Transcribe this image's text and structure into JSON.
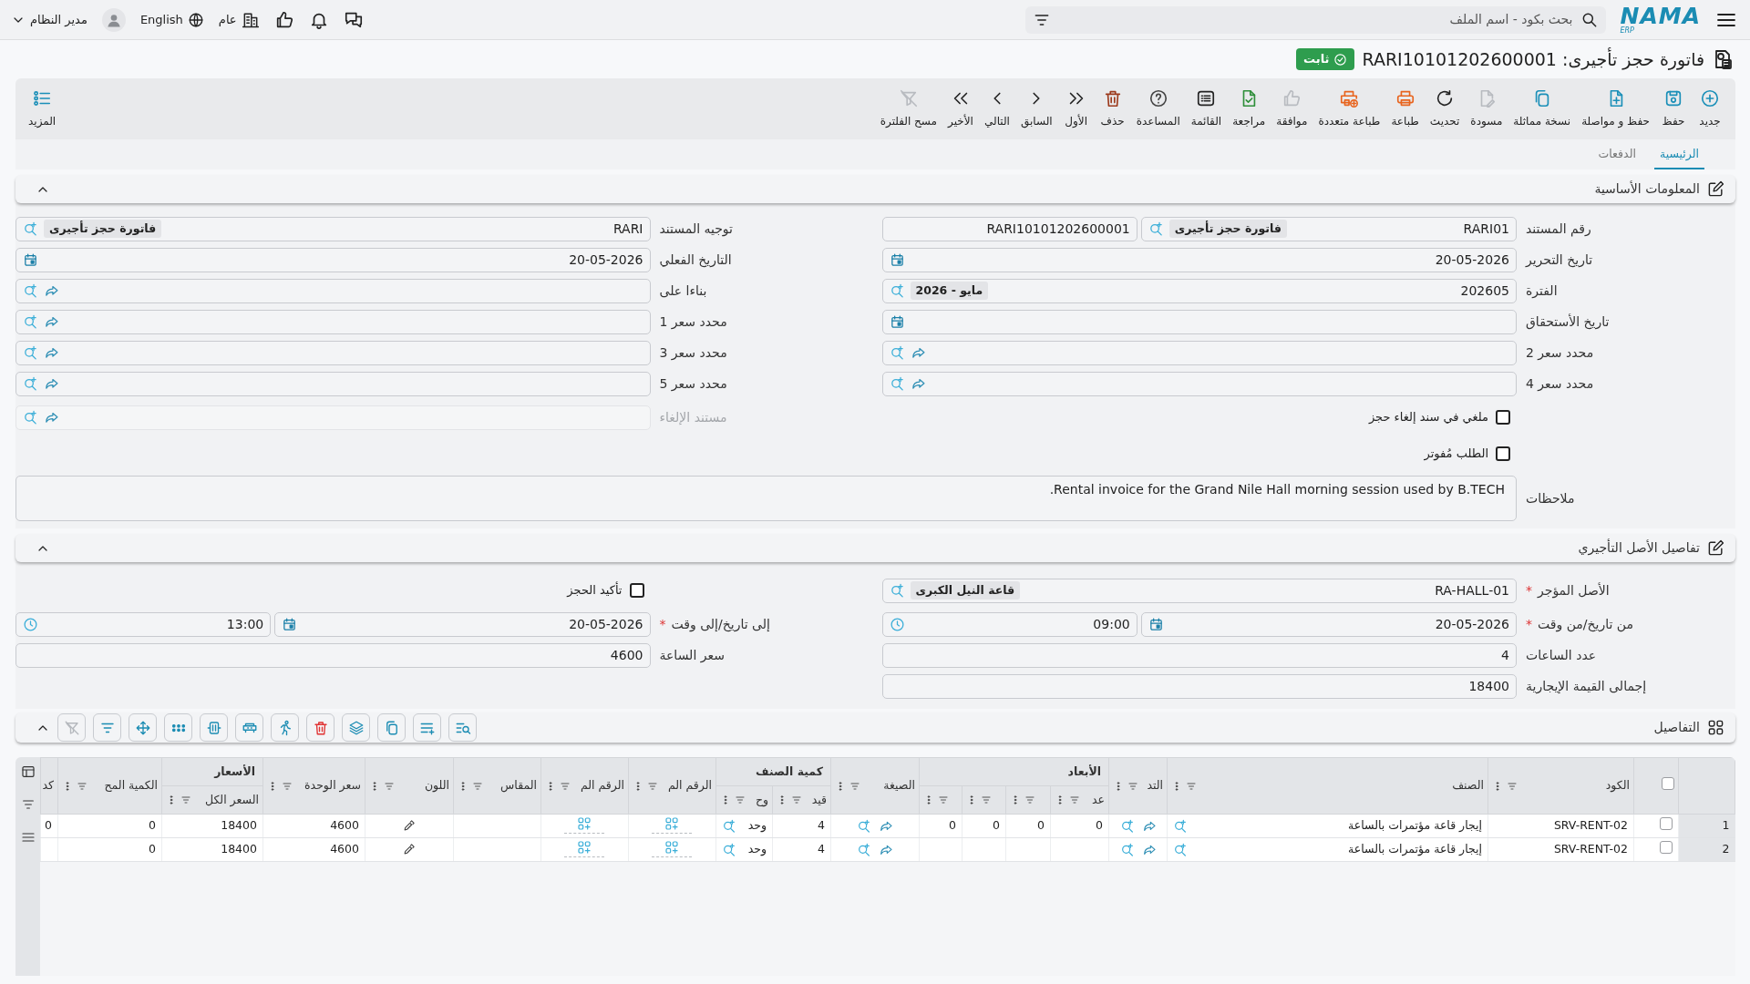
{
  "topbar": {
    "logo": "NAMA",
    "logo_sub": "ERP",
    "search": {
      "placeholder": "بحث بكود - اسم الملف"
    },
    "company": "عام",
    "language": "English",
    "user": "مدير النظام"
  },
  "title": "فاتورة حجز تأجيرى: RARI10101202600001",
  "status_badge": "ثابت",
  "toolbar": [
    {
      "kind": "new",
      "label": "جديد",
      "disabled": false
    },
    {
      "kind": "save",
      "label": "حفظ",
      "disabled": false
    },
    {
      "kind": "save-continue",
      "label": "حفظ و مواصلة",
      "disabled": false
    },
    {
      "kind": "duplicate",
      "label": "نسخة مماثلة",
      "disabled": false
    },
    {
      "kind": "draft",
      "label": "مسودة",
      "disabled": true
    },
    {
      "kind": "refresh",
      "label": "تحديث",
      "disabled": false
    },
    {
      "kind": "print",
      "label": "طباعة",
      "disabled": false
    },
    {
      "kind": "print-multiple",
      "label": "طباعة متعددة",
      "disabled": false
    },
    {
      "kind": "approve",
      "label": "موافقة",
      "disabled": true
    },
    {
      "kind": "review",
      "label": "مراجعة",
      "disabled": false
    },
    {
      "kind": "list",
      "label": "القائمة",
      "disabled": false
    },
    {
      "kind": "help",
      "label": "المساعدة",
      "disabled": false
    },
    {
      "kind": "delete",
      "label": "حذف",
      "disabled": false
    },
    {
      "kind": "first",
      "label": "الأول",
      "disabled": false
    },
    {
      "kind": "previous",
      "label": "السابق",
      "disabled": false
    },
    {
      "kind": "next",
      "label": "التالي",
      "disabled": false
    },
    {
      "kind": "last",
      "label": "الأخير",
      "disabled": false
    },
    {
      "kind": "clear-filter",
      "label": "مسح الفلترة",
      "disabled": true
    }
  ],
  "more_button": "المزيد",
  "tabs": [
    {
      "label": "الرئيسية",
      "selected": true
    },
    {
      "label": "الدفعات",
      "selected": false
    }
  ],
  "sections": [
    {
      "kind": "form",
      "title": "المعلومات الأساسية",
      "expanded": true,
      "columns": [
        [
          {
            "kind": "field",
            "label": "رقم المستند",
            "disabled": false,
            "inputs": [
              {
                "kind": "lookup",
                "value": "RARI01",
                "tag": "فاتورة حجز تأجيرى"
              },
              {
                "kind": "text",
                "value": "RARI10101202600001"
              }
            ]
          },
          {
            "kind": "field",
            "label": "تاريخ التحرير",
            "disabled": false,
            "inputs": [
              {
                "kind": "date",
                "value": "20-05-2026"
              }
            ]
          },
          {
            "kind": "field",
            "label": "الفترة",
            "disabled": false,
            "inputs": [
              {
                "kind": "lookup",
                "value": "202605",
                "tag": "مايو - 2026"
              }
            ]
          },
          {
            "kind": "field",
            "label": "تاريخ الأستحقاق",
            "disabled": false,
            "inputs": [
              {
                "kind": "date"
              }
            ]
          },
          {
            "kind": "field",
            "label": "محدد سعر 2",
            "disabled": false,
            "inputs": [
              {
                "kind": "reference"
              }
            ]
          },
          {
            "kind": "field",
            "label": "محدد سعر 4",
            "disabled": false,
            "inputs": [
              {
                "kind": "reference"
              }
            ]
          },
          {
            "kind": "checkbox",
            "label": "ملغي في سند إلغاء حجز",
            "checked": false
          },
          {
            "kind": "checkbox",
            "label": "الطلب مُفوتر",
            "checked": false
          }
        ],
        [
          {
            "kind": "field",
            "label": "توجيه المستند",
            "disabled": false,
            "inputs": [
              {
                "kind": "lookup",
                "value": "RARI",
                "tag": "فاتورة حجز تأجيرى"
              }
            ]
          },
          {
            "kind": "field",
            "label": "التاريخ الفعلي",
            "disabled": false,
            "inputs": [
              {
                "kind": "date",
                "value": "20-05-2026"
              }
            ]
          },
          {
            "kind": "field",
            "label": "بناءا على",
            "disabled": false,
            "inputs": [
              {
                "kind": "reference"
              }
            ]
          },
          {
            "kind": "field",
            "label": "محدد سعر 1",
            "disabled": false,
            "inputs": [
              {
                "kind": "reference"
              }
            ]
          },
          {
            "kind": "field",
            "label": "محدد سعر 3",
            "disabled": false,
            "inputs": [
              {
                "kind": "reference"
              }
            ]
          },
          {
            "kind": "field",
            "label": "محدد سعر 5",
            "disabled": false,
            "inputs": [
              {
                "kind": "reference"
              }
            ]
          },
          {
            "kind": "field",
            "label": "مستند الإلغاء",
            "disabled": true,
            "inputs": [
              {
                "kind": "reference"
              }
            ]
          }
        ]
      ],
      "notes": {
        "label": "ملاحظات",
        "value": "Rental invoice for the Grand Nile Hall morning session used by B.TECH."
      }
    },
    {
      "kind": "form",
      "title": "تفاصيل الأصل التأجيري",
      "expanded": true,
      "columns": [
        [
          {
            "kind": "field",
            "label": "الأصل المؤجر",
            "required_mark": "*",
            "disabled": false,
            "inputs": [
              {
                "kind": "lookup",
                "value": "RA-HALL-01",
                "tag": "قاعة النيل الكبرى"
              }
            ]
          },
          {
            "kind": "field",
            "label": "من تاريخ/من وقت",
            "required_mark": "*",
            "disabled": false,
            "inputs": [
              {
                "kind": "date",
                "value": "20-05-2026"
              },
              {
                "kind": "time",
                "value": "09:00"
              }
            ]
          },
          {
            "kind": "field",
            "label": "عدد الساعات",
            "disabled": false,
            "inputs": [
              {
                "kind": "text",
                "value": "4"
              }
            ]
          },
          {
            "kind": "field",
            "label": "إجمالى القيمة الإيجارية",
            "disabled": false,
            "inputs": [
              {
                "kind": "text",
                "value": "18400"
              }
            ]
          }
        ],
        [
          {
            "kind": "checkbox",
            "label": "تأكيد الحجز",
            "checked": false
          },
          {
            "kind": "field",
            "label": "إلى تاريخ/إلى وقت",
            "required_mark": "*",
            "disabled": false,
            "inputs": [
              {
                "kind": "date",
                "value": "20-05-2026"
              },
              {
                "kind": "time",
                "value": "13:00"
              }
            ]
          },
          {
            "kind": "field",
            "label": "سعر الساعة",
            "disabled": false,
            "inputs": [
              {
                "kind": "text",
                "value": "4600"
              }
            ]
          }
        ]
      ]
    },
    {
      "kind": "grid",
      "title": "التفاصيل",
      "expanded": true,
      "tools": [
        {
          "kind": "find",
          "disabled": false
        },
        {
          "kind": "add-row",
          "disabled": false
        },
        {
          "kind": "copy",
          "disabled": false
        },
        {
          "kind": "layers",
          "disabled": false
        },
        {
          "kind": "delete",
          "disabled": false
        },
        {
          "kind": "run",
          "disabled": false
        },
        {
          "kind": "row",
          "disabled": false
        },
        {
          "kind": "fit",
          "disabled": false
        },
        {
          "kind": "dots",
          "disabled": false
        },
        {
          "kind": "move",
          "disabled": false
        },
        {
          "kind": "filter",
          "disabled": false
        },
        {
          "kind": "clear-filter",
          "disabled": true
        }
      ],
      "table": {
        "all_selected": false,
        "columns": [
          {
            "label": "الكود",
            "kind": "text"
          },
          {
            "label": "الصنف",
            "kind": "lookup"
          },
          {
            "label": "التد",
            "kind": "reference"
          },
          {
            "group": "الأبعاد",
            "colspan": 4,
            "children": [
              {
                "label": "عد",
                "kind": "text"
              },
              {
                "kind": "text"
              },
              {
                "kind": "text"
              },
              {
                "kind": "text"
              }
            ]
          },
          {
            "label": "الصيغة",
            "kind": "reference"
          },
          {
            "group": "كمية الصنف",
            "colspan": 2,
            "children": [
              {
                "label": "قيد",
                "kind": "text"
              },
              {
                "label": "وح",
                "kind": "lookup"
              }
            ]
          },
          {
            "label": "الرقم الم",
            "kind": "grid-add"
          },
          {
            "label": "الرقم الم",
            "kind": "grid-add"
          },
          {
            "label": "المقاس",
            "kind": "text"
          },
          {
            "label": "اللون",
            "kind": "color"
          },
          {
            "label": "سعر الوحدة",
            "kind": "text"
          },
          {
            "group": "الأسعار",
            "children": [
              {
                "label": "السعر الكل",
                "kind": "text"
              }
            ]
          },
          {
            "label": "الكمية المح",
            "kind": "text"
          },
          {
            "label": "كد",
            "kind": "text"
          }
        ],
        "rows": [
          {
            "number": "1",
            "selected": false,
            "cells": [
              "SRV-RENT-02",
              "إيجار قاعة مؤتمرات بالساعة",
              null,
              "0",
              "0",
              "0",
              "0",
              null,
              "4",
              "وحد",
              null,
              null,
              null,
              null,
              "4600",
              "18400",
              "0",
              "0"
            ]
          },
          {
            "number": "2",
            "selected": false,
            "cells": [
              "SRV-RENT-02",
              "إيجار قاعة مؤتمرات بالساعة",
              null,
              null,
              null,
              null,
              null,
              null,
              "4",
              "وحد",
              null,
              null,
              null,
              null,
              "4600",
              "18400",
              "0",
              null
            ]
          }
        ]
      }
    }
  ]
}
